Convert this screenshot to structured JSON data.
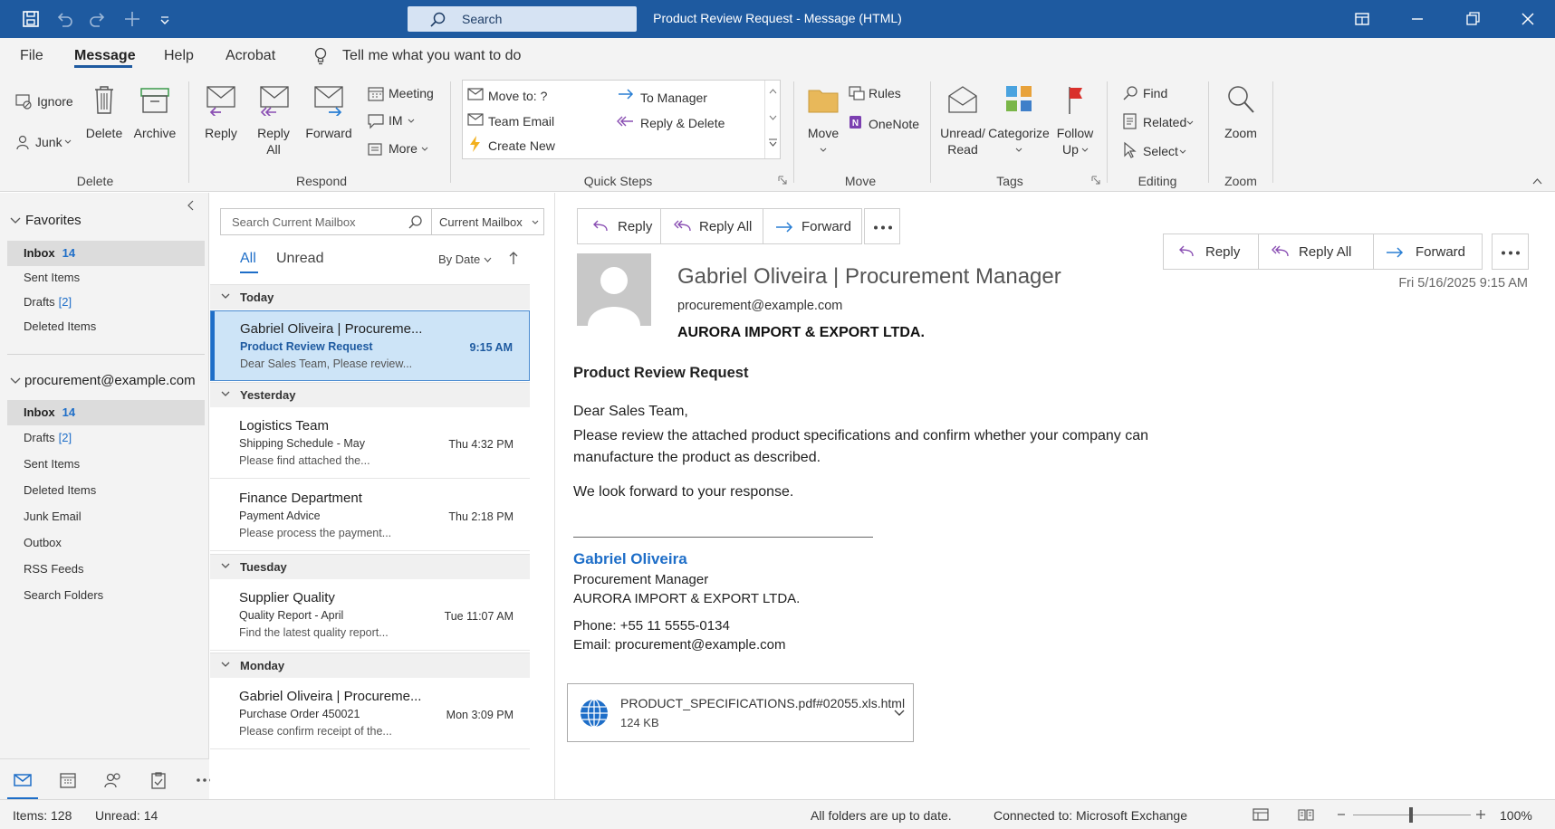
{
  "titlebar": {
    "search_label": "Search",
    "window_title": "Product Review Request - Message (HTML)"
  },
  "menu": {
    "items": [
      "File",
      "Message",
      "Help",
      "Acrobat"
    ],
    "tell_me": "Tell me what you want to do"
  },
  "ribbon": {
    "delete_group": {
      "ignore": "Ignore",
      "junk": "Junk",
      "delete": "Delete",
      "archive": "Archive",
      "label": "Delete"
    },
    "respond_group": {
      "reply": "Reply",
      "reply_all_1": "Reply",
      "reply_all_2": "All",
      "forward": "Forward",
      "meeting": "Meeting",
      "im": "IM",
      "more": "More",
      "label": "Respond"
    },
    "quick_steps": {
      "move_to": "Move to: ?",
      "team_email": "Team Email",
      "create_new": "Create New",
      "to_manager": "To Manager",
      "reply_delete": "Reply & Delete",
      "label": "Quick Steps"
    },
    "move_group": {
      "move": "Move",
      "rules": "Rules",
      "onenote": "OneNote",
      "label": "Move"
    },
    "tags_group": {
      "unread_1": "Unread/",
      "unread_2": "Read",
      "categorize": "Categorize",
      "follow_1": "Follow",
      "follow_2": "Up",
      "label": "Tags"
    },
    "editing_group": {
      "find": "Find",
      "related": "Related",
      "select": "Select",
      "label": "Editing"
    },
    "zoom_group": {
      "zoom": "Zoom",
      "label": "Zoom"
    }
  },
  "nav": {
    "favorites_header": "Favorites",
    "favorites": [
      {
        "label": "Inbox",
        "count": "14"
      },
      {
        "label": "Sent Items",
        "count": ""
      },
      {
        "label": "Drafts",
        "count": "[2]"
      },
      {
        "label": "Deleted Items",
        "count": ""
      }
    ],
    "account_header": "procurement@example.com",
    "folders": [
      {
        "label": "Inbox",
        "count": "14"
      },
      {
        "label": "Drafts",
        "count": "[2]"
      },
      {
        "label": "Sent Items",
        "count": ""
      },
      {
        "label": "Deleted Items",
        "count": ""
      },
      {
        "label": "Junk Email",
        "count": ""
      },
      {
        "label": "Outbox",
        "count": ""
      },
      {
        "label": "RSS Feeds",
        "count": ""
      },
      {
        "label": "Search Folders",
        "count": ""
      }
    ]
  },
  "list": {
    "search_placeholder": "Search Current Mailbox",
    "scope": "Current Mailbox",
    "filter_all": "All",
    "filter_unread": "Unread",
    "sort": "By Date",
    "groups": [
      "Today",
      "Yesterday",
      "Tuesday",
      "Monday"
    ],
    "messages": [
      {
        "from": "Gabriel Oliveira | Procureme...",
        "subject": "Product Review Request",
        "time": "9:15 AM",
        "preview": "Dear Sales Team,  Please review..."
      },
      {
        "from": "Logistics Team",
        "subject": "Shipping Schedule - May",
        "time": "Thu 4:32 PM",
        "preview": "Please find attached the..."
      },
      {
        "from": "Finance Department",
        "subject": "Payment Advice",
        "time": "Thu 2:18 PM",
        "preview": "Please process the payment..."
      },
      {
        "from": "Supplier Quality",
        "subject": "Quality Report - April",
        "time": "Tue 11:07 AM",
        "preview": "Find the latest quality report..."
      },
      {
        "from": "Gabriel Oliveira | Procureme...",
        "subject": "Purchase Order 450021",
        "time": "Mon 3:09 PM",
        "preview": "Please confirm receipt of the..."
      }
    ]
  },
  "reading": {
    "actions": {
      "reply": "Reply",
      "reply_all": "Reply All",
      "forward": "Forward"
    },
    "sender_name": "Gabriel Oliveira | Procurement Manager",
    "sender_email": "procurement@example.com",
    "sender_company": "AURORA IMPORT & EXPORT LTDA.",
    "date": "Fri 5/16/2025 9:15 AM",
    "subject": "Product Review Request",
    "greeting": "Dear Sales Team,",
    "body_line1": "Please review the attached product specifications and confirm whether your company can",
    "body_line2": "manufacture the product as described.",
    "closing": "We look forward to your response.",
    "signature": {
      "name": "Gabriel Oliveira",
      "title": "Procurement Manager",
      "company": "AURORA IMPORT & EXPORT LTDA.",
      "phone": "Phone: +55 11 5555-0134",
      "email": "Email: procurement@example.com"
    },
    "attachment": {
      "name": "PRODUCT_SPECIFICATIONS.pdf#02055.xls.html",
      "size": "124 KB"
    }
  },
  "status": {
    "items": "Items: 128",
    "unread": "Unread: 14",
    "sync": "All folders are up to date.",
    "connection": "Connected to: Microsoft Exchange",
    "zoom": "100%"
  },
  "colors": {
    "accent": "#1e5aa0",
    "link": "#1e6ec8",
    "selected": "#cde4f7"
  }
}
